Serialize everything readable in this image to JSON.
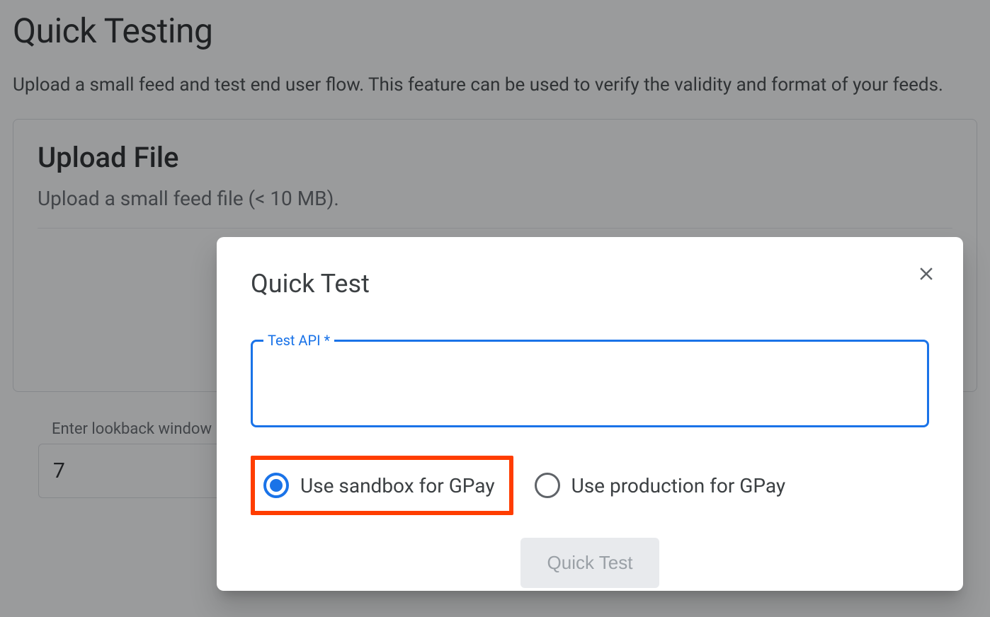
{
  "page": {
    "title": "Quick Testing",
    "description": "Upload a small feed and test end user flow. This feature can be used to verify the validity and format of your feeds."
  },
  "upload_card": {
    "title": "Upload File",
    "description": "Upload a small feed file (< 10 MB)."
  },
  "lookback": {
    "label": "Enter lookback window",
    "value": "7"
  },
  "dialog": {
    "title": "Quick Test",
    "field_label": "Test API *",
    "field_value": "",
    "radio_sandbox": "Use sandbox for GPay",
    "radio_production": "Use production for GPay",
    "submit_label": "Quick Test"
  }
}
